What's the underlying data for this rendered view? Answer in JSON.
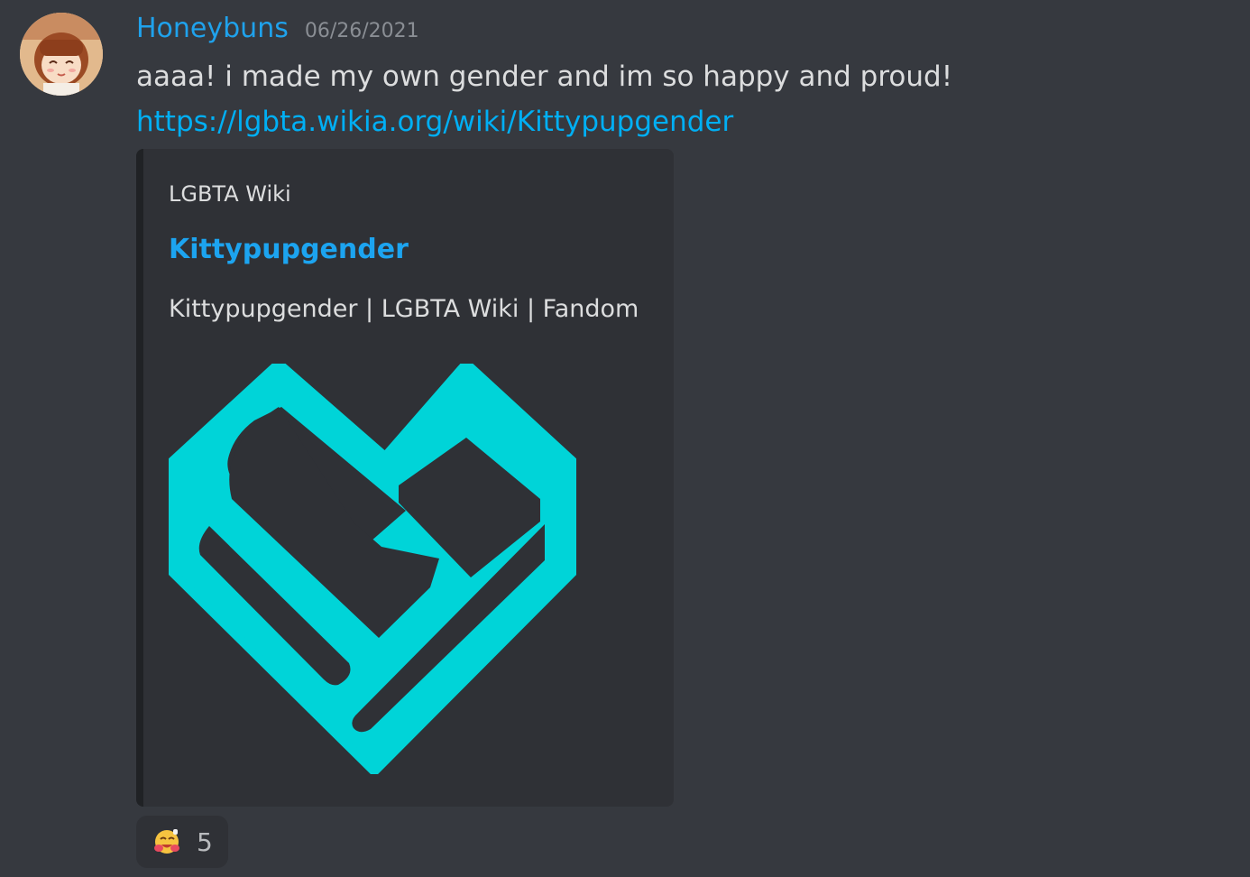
{
  "message": {
    "author": "Honeybuns",
    "timestamp": "06/26/2021",
    "text": "aaaa! i made my own gender and im so happy and proud!",
    "link": "https://lgbta.wikia.org/wiki/Kittypupgender"
  },
  "embed": {
    "provider": "LGBTA Wiki",
    "title": "Kittypupgender",
    "description": "Kittypupgender | LGBTA Wiki | Fandom",
    "image_icon": "fandom-heart-logo",
    "image_color": "#00d4d8"
  },
  "reaction": {
    "emoji_icon": "hug-emoji-icon",
    "count": "5"
  },
  "colors": {
    "background": "#36393f",
    "username": "#1fa2ec",
    "link": "#00aff4",
    "embed_background": "#2f3136"
  }
}
